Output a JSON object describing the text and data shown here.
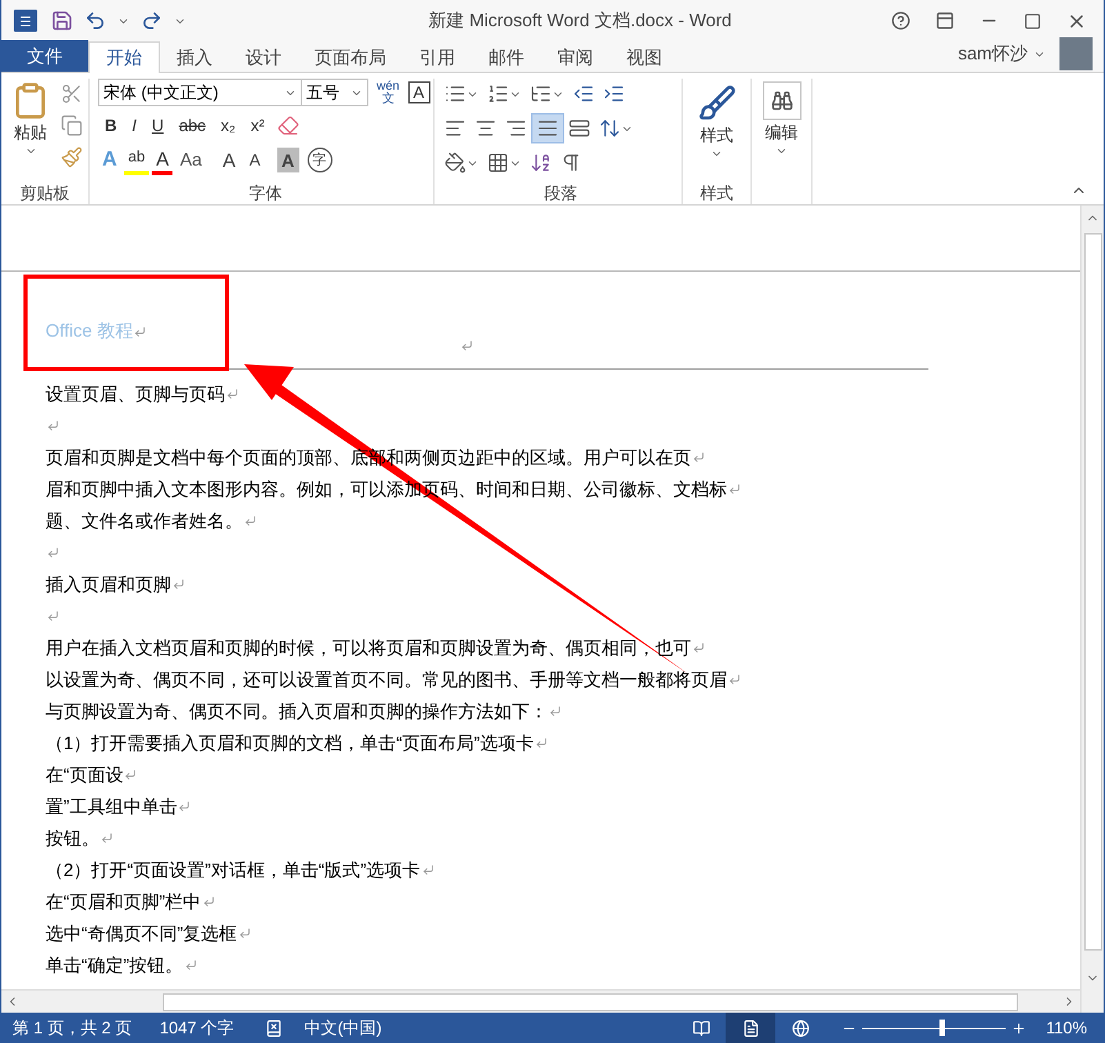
{
  "window": {
    "title": "新建 Microsoft Word 文档.docx - Word"
  },
  "tabs": [
    {
      "label": "文件",
      "kind": "file",
      "selected": false
    },
    {
      "label": "开始",
      "kind": "tab",
      "selected": true
    },
    {
      "label": "插入",
      "kind": "tab",
      "selected": false
    },
    {
      "label": "设计",
      "kind": "tab",
      "selected": false
    },
    {
      "label": "页面布局",
      "kind": "tab",
      "selected": false
    },
    {
      "label": "引用",
      "kind": "tab",
      "selected": false
    },
    {
      "label": "邮件",
      "kind": "tab",
      "selected": false
    },
    {
      "label": "审阅",
      "kind": "tab",
      "selected": false
    },
    {
      "label": "视图",
      "kind": "tab",
      "selected": false
    }
  ],
  "user": {
    "name": "sam怀沙"
  },
  "ribbon": {
    "clipboard": {
      "paste_label": "粘贴",
      "group_label": "剪贴板"
    },
    "font": {
      "font_name": "宋体 (中文正文)",
      "font_size": "五号",
      "pinyin_top": "wén",
      "pinyin_bottom": "文",
      "border_char": "A",
      "format_buttons": [
        "B",
        "I",
        "U",
        "abc",
        "x₂",
        "x²"
      ],
      "effect_char": "A",
      "highlight_char": "ab",
      "color_char": "A",
      "case_label": "Aa",
      "grow_char": "A",
      "shrink_char": "A",
      "shading_char": "A",
      "enclosed_char": "字",
      "group_label": "字体"
    },
    "paragraph": {
      "align_buttons": [
        {
          "selected": false
        },
        {
          "selected": false
        },
        {
          "selected": false
        },
        {
          "selected": true
        },
        {
          "selected": false
        }
      ],
      "group_label": "段落"
    },
    "styles": {
      "label": "样式",
      "group_label": "样式"
    },
    "editing": {
      "label": "编辑"
    }
  },
  "document": {
    "header_text": "Office 教程",
    "lines": [
      {
        "kind": "text",
        "text": "设置页眉、页脚与页码"
      },
      {
        "kind": "blank"
      },
      {
        "kind": "text",
        "text": "页眉和页脚是文档中每个页面的顶部、底部和两侧页边距中的区域。用户可以在页"
      },
      {
        "kind": "text",
        "text": "眉和页脚中插入文本图形内容。例如，可以添加页码、时间和日期、公司徽标、文档标"
      },
      {
        "kind": "text",
        "text": "题、文件名或作者姓名。"
      },
      {
        "kind": "blank"
      },
      {
        "kind": "text",
        "text": "插入页眉和页脚"
      },
      {
        "kind": "blank"
      },
      {
        "kind": "text",
        "text": "用户在插入文档页眉和页脚的时候，可以将页眉和页脚设置为奇、偶页相同，也可"
      },
      {
        "kind": "text",
        "text": "以设置为奇、偶页不同，还可以设置首页不同。常见的图书、手册等文档一般都将页眉"
      },
      {
        "kind": "text",
        "text": "与页脚设置为奇、偶页不同。插入页眉和页脚的操作方法如下："
      },
      {
        "kind": "text",
        "text": "（1）打开需要插入页眉和页脚的文档，单击“页面布局”选项卡"
      },
      {
        "kind": "text",
        "text": "在“页面设"
      },
      {
        "kind": "text",
        "text": "置”工具组中单击"
      },
      {
        "kind": "text",
        "text": "按钮。"
      },
      {
        "kind": "text",
        "text": "（2）打开“页面设置”对话框，单击“版式”选项卡"
      },
      {
        "kind": "text",
        "text": "在“页眉和页脚”栏中"
      },
      {
        "kind": "text",
        "text": "选中“奇偶页不同”复选框"
      },
      {
        "kind": "text",
        "text": "单击“确定”按钮。"
      }
    ]
  },
  "status_bar": {
    "page": "第 1 页，共 2 页",
    "words": "1047 个字",
    "language": "中文(中国)",
    "views": [
      {
        "selected": false
      },
      {
        "selected": true
      },
      {
        "selected": false
      }
    ],
    "zoom_slider": {
      "level": 0.56
    },
    "zoom": "110%"
  }
}
